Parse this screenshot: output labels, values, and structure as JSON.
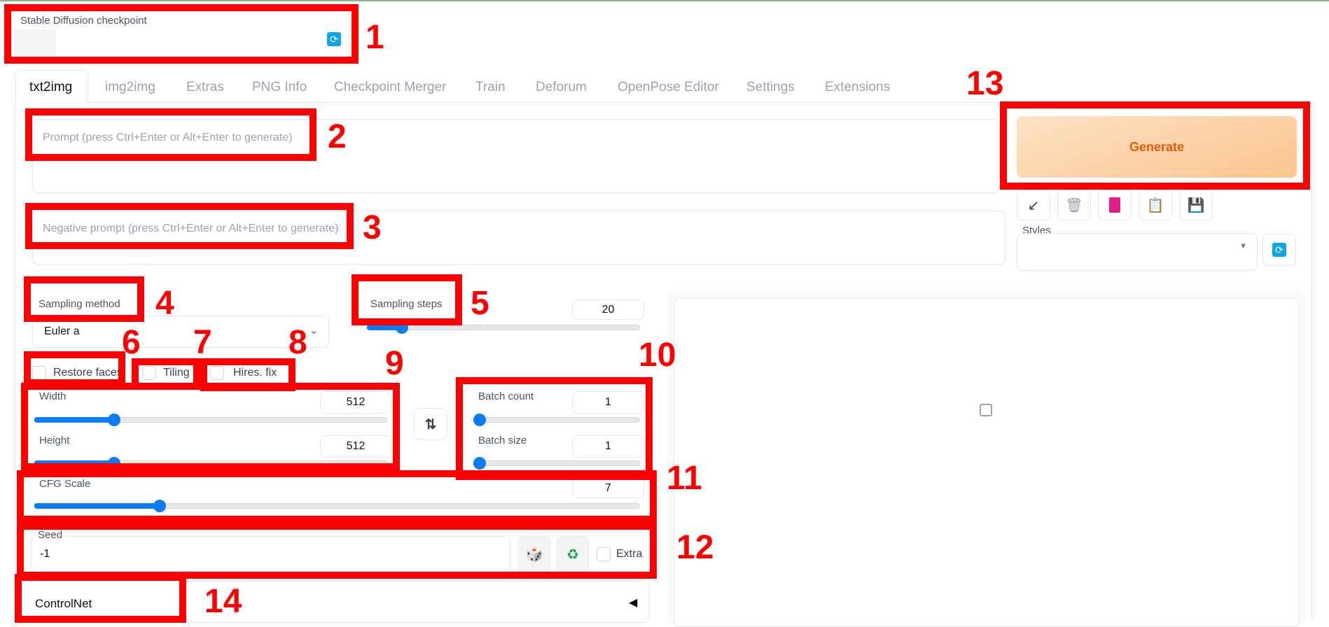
{
  "checkpoint": {
    "label": "Stable Diffusion checkpoint",
    "value": ""
  },
  "tabs": [
    "txt2img",
    "img2img",
    "Extras",
    "PNG Info",
    "Checkpoint Merger",
    "Train",
    "Deforum",
    "OpenPose Editor",
    "Settings",
    "Extensions"
  ],
  "active_tab": "txt2img",
  "prompt": {
    "placeholder": "Prompt (press Ctrl+Enter or Alt+Enter to generate)"
  },
  "negative_prompt": {
    "placeholder": "Negative prompt (press Ctrl+Enter or Alt+Enter to generate)"
  },
  "generate": {
    "label": "Generate",
    "color": "#ea580c"
  },
  "tool_buttons": [
    "arrow-icon",
    "trash-icon",
    "picture-icon",
    "clipboard-icon",
    "save-icon"
  ],
  "styles": {
    "label": "Styles",
    "value": ""
  },
  "sampling_method": {
    "label": "Sampling method",
    "value": "Euler a"
  },
  "sampling_steps": {
    "label": "Sampling steps",
    "value": "20",
    "min": 1,
    "max": 150
  },
  "checkboxes": {
    "restore_faces": "Restore faces",
    "tiling": "Tiling",
    "hires_fix": "Hires. fix"
  },
  "width": {
    "label": "Width",
    "value": "512",
    "min": 64,
    "max": 2048
  },
  "height": {
    "label": "Height",
    "value": "512",
    "min": 64,
    "max": 2048
  },
  "batch_count": {
    "label": "Batch count",
    "value": "1",
    "min": 1,
    "max": 100
  },
  "batch_size": {
    "label": "Batch size",
    "value": "1",
    "min": 1,
    "max": 8
  },
  "cfg_scale": {
    "label": "CFG Scale",
    "value": "7",
    "min": 1,
    "max": 30
  },
  "seed": {
    "label": "Seed",
    "value": "-1",
    "extra": "Extra"
  },
  "controlnet": {
    "label": "ControlNet"
  },
  "annotations": [
    "1",
    "2",
    "3",
    "4",
    "5",
    "6",
    "7",
    "8",
    "9",
    "10",
    "11",
    "12",
    "13",
    "14"
  ],
  "accent": "#0b7cf5",
  "annotation_color": "#ff0000"
}
